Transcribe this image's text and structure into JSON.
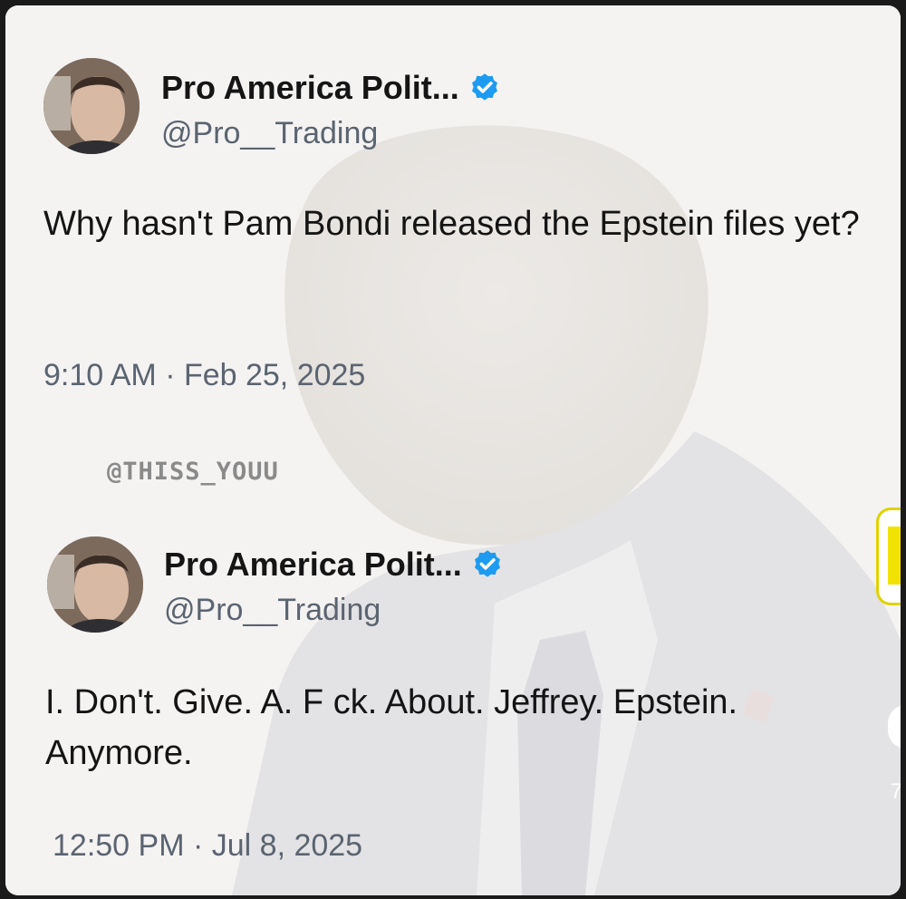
{
  "tweets": [
    {
      "display_name": "Pro America Polit...",
      "handle": "@Pro__Trading",
      "text": "Why hasn't Pam Bondi released the Epstein files yet?",
      "timestamp": "9:10 AM · Feb 25, 2025"
    },
    {
      "display_name": "Pro America Polit...",
      "handle": "@Pro__Trading",
      "text": "I. Don't. Give. A. F ck. About. Jeffrey. Epstein. Anymore.",
      "timestamp": "12:50 PM · Jul 8, 2025"
    }
  ],
  "watermark": "@THISS_YOUU",
  "edge_count": "7",
  "colors": {
    "background": "#f4f3f2",
    "verified_badge": "#1d9bf0",
    "secondary_text": "#5b6470",
    "primary_text": "#141414"
  },
  "icons": {
    "verified": "verified-badge-icon"
  }
}
